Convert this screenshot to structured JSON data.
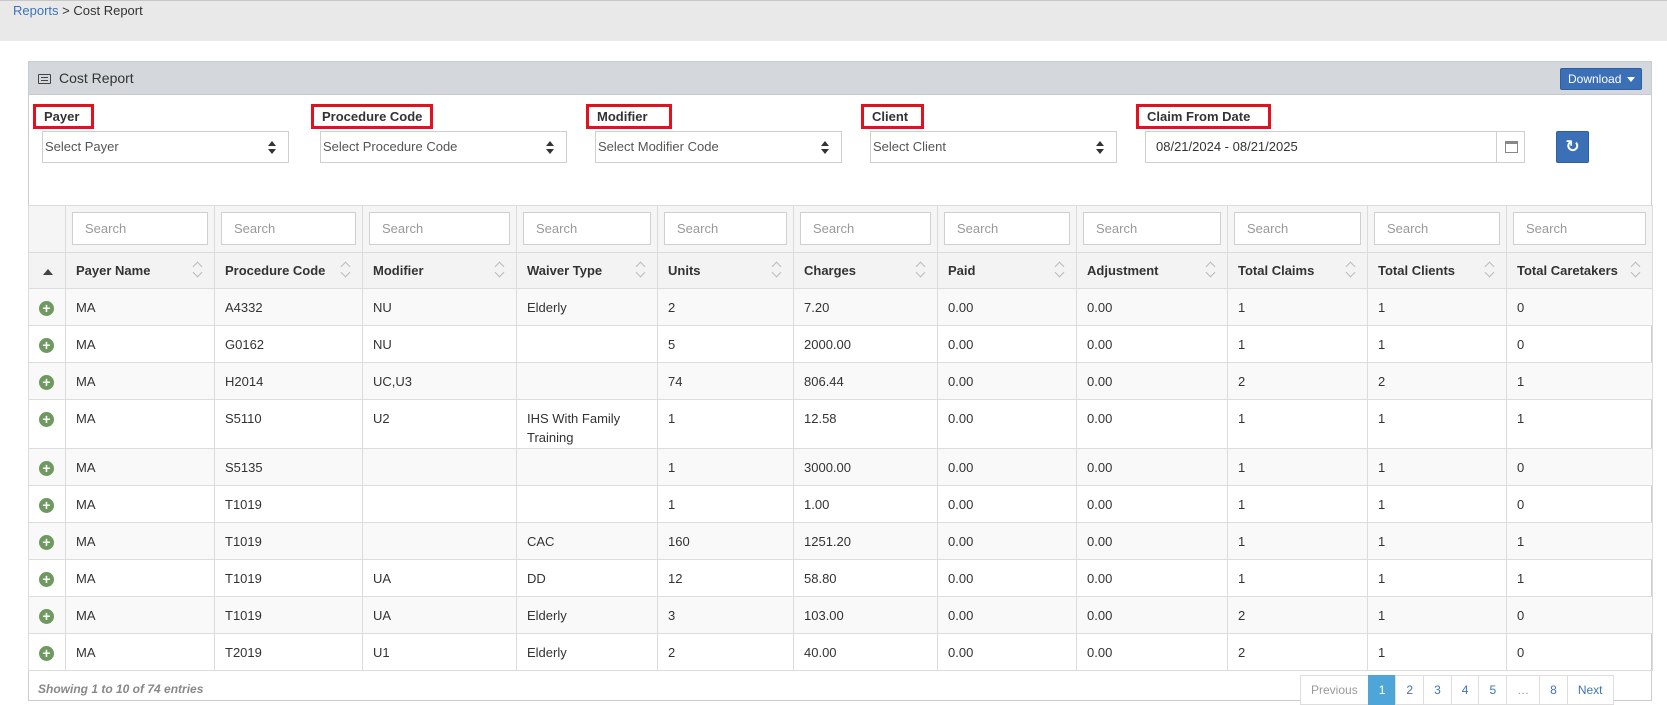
{
  "breadcrumb": {
    "parent": "Reports",
    "separator": " > ",
    "current": "Cost Report"
  },
  "panel": {
    "title": "Cost Report",
    "download_label": "Download"
  },
  "filters": [
    {
      "label": "Payer",
      "placeholder": "Select Payer"
    },
    {
      "label": "Procedure Code",
      "placeholder": "Select Procedure Code"
    },
    {
      "label": "Modifier",
      "placeholder": "Select Modifier Code"
    },
    {
      "label": "Client",
      "placeholder": "Select Client"
    },
    {
      "label": "Claim From Date",
      "value": "08/21/2024 - 08/21/2025"
    }
  ],
  "search_placeholder": "Search",
  "columns": [
    "Payer Name",
    "Procedure Code",
    "Modifier",
    "Waiver Type",
    "Units",
    "Charges",
    "Paid",
    "Adjustment",
    "Total Claims",
    "Total Clients",
    "Total Caretakers"
  ],
  "rows": [
    [
      "MA",
      "A4332",
      "NU",
      "Elderly",
      "2",
      "7.20",
      "0.00",
      "0.00",
      "1",
      "1",
      "0"
    ],
    [
      "MA",
      "G0162",
      "NU",
      "",
      "5",
      "2000.00",
      "0.00",
      "0.00",
      "1",
      "1",
      "0"
    ],
    [
      "MA",
      "H2014",
      "UC,U3",
      "",
      "74",
      "806.44",
      "0.00",
      "0.00",
      "2",
      "2",
      "1"
    ],
    [
      "MA",
      "S5110",
      "U2",
      "IHS With Family Training",
      "1",
      "12.58",
      "0.00",
      "0.00",
      "1",
      "1",
      "1"
    ],
    [
      "MA",
      "S5135",
      "",
      "",
      "1",
      "3000.00",
      "0.00",
      "0.00",
      "1",
      "1",
      "0"
    ],
    [
      "MA",
      "T1019",
      "",
      "",
      "1",
      "1.00",
      "0.00",
      "0.00",
      "1",
      "1",
      "0"
    ],
    [
      "MA",
      "T1019",
      "",
      "CAC",
      "160",
      "1251.20",
      "0.00",
      "0.00",
      "1",
      "1",
      "1"
    ],
    [
      "MA",
      "T1019",
      "UA",
      "DD",
      "12",
      "58.80",
      "0.00",
      "0.00",
      "1",
      "1",
      "1"
    ],
    [
      "MA",
      "T1019",
      "UA",
      "Elderly",
      "3",
      "103.00",
      "0.00",
      "0.00",
      "2",
      "1",
      "0"
    ],
    [
      "MA",
      "T2019",
      "U1",
      "Elderly",
      "2",
      "40.00",
      "0.00",
      "0.00",
      "2",
      "1",
      "0"
    ]
  ],
  "footer": {
    "info": "Showing 1 to 10 of 74 entries"
  },
  "pagination": {
    "previous": "Previous",
    "pages": [
      "1",
      "2",
      "3",
      "4",
      "5",
      "…",
      "8"
    ],
    "next": "Next",
    "active": "1"
  },
  "colors": {
    "accent": "#3b6fb6",
    "highlight": "#e3101d",
    "expand": "#6e9a5f",
    "active_page": "#4ea5d8"
  },
  "icons": {
    "panel": "table-icon",
    "expand": "plus-circle-icon",
    "refresh": "refresh-icon",
    "calendar": "calendar-icon",
    "download_caret": "caret-down-icon"
  }
}
